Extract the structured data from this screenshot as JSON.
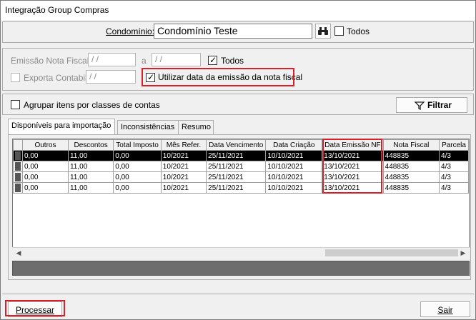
{
  "window": {
    "title": "Integração Group Compras"
  },
  "condominio": {
    "label": "Condomínio:",
    "value": "Condomínio Teste",
    "search_icon": "binoculars-icon",
    "todos_label": "Todos",
    "todos_checked": false
  },
  "filters": {
    "emissao_label": "Emissão Nota Fiscal:",
    "date_from": " / /",
    "sep": "a",
    "date_to": " / /",
    "todos_label": "Todos",
    "todos_checked": true,
    "exporta_label": "Exporta Contabil:",
    "exporta_date": " / /",
    "exporta_checked": false,
    "utilizar_label": "Utilizar data da emissão da nota fiscal",
    "utilizar_checked": true
  },
  "agrupar": {
    "label": "Agrupar itens por classes de contas",
    "checked": false
  },
  "filtrar_button": {
    "label": "Filtrar",
    "icon": "funnel-icon"
  },
  "tabs": [
    {
      "label": "Disponíveis para importação"
    },
    {
      "label": "Inconsistências"
    },
    {
      "label": "Resumo"
    }
  ],
  "grid": {
    "columns": [
      "Outros",
      "Descontos",
      "Total Imposto",
      "Mês Refer.",
      "Data Vencimento",
      "Data Criação",
      "Data Emissão NF",
      "Nota Fiscal",
      "Parcela"
    ],
    "rows": [
      [
        "0,00",
        "11,00",
        "0,00",
        "10/2021",
        "25/11/2021",
        "10/10/2021",
        "13/10/2021",
        "448835",
        "4/3"
      ],
      [
        "0,00",
        "11,00",
        "0,00",
        "10/2021",
        "25/11/2021",
        "10/10/2021",
        "13/10/2021",
        "448835",
        "4/3"
      ],
      [
        "0,00",
        "11,00",
        "0,00",
        "10/2021",
        "25/11/2021",
        "10/10/2021",
        "13/10/2021",
        "448835",
        "4/3"
      ],
      [
        "0,00",
        "11,00",
        "0,00",
        "10/2021",
        "25/11/2021",
        "10/10/2021",
        "13/10/2021",
        "448835",
        "4/3"
      ]
    ]
  },
  "footer": {
    "processar_label": "Processar",
    "sair_label": "Sair"
  },
  "colors": {
    "highlight": "#d8202a",
    "selected_row": "#000000",
    "status_bar": "#6d6d6d"
  }
}
